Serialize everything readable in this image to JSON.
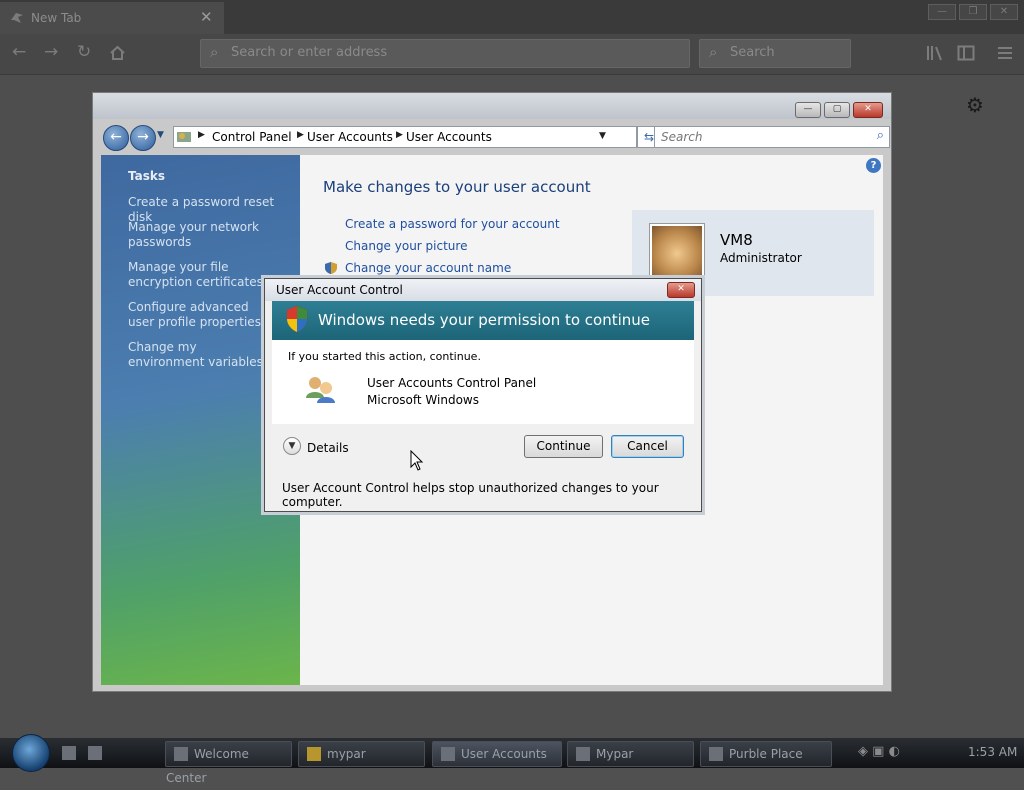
{
  "browser": {
    "tab_title": "New Tab",
    "address_placeholder": "Search or enter address",
    "search_placeholder": "Search"
  },
  "control_panel": {
    "breadcrumb": [
      "Control Panel",
      "User Accounts",
      "User Accounts"
    ],
    "search_placeholder": "Search",
    "tasks_heading": "Tasks",
    "tasks": [
      "Create a password reset disk",
      "Manage your network passwords",
      "Manage your file encryption certificates",
      "Configure advanced user profile properties",
      "Change my environment variables"
    ],
    "heading": "Make changes to your user account",
    "links": [
      "Create a password for your account",
      "Change your picture",
      "Change your account name"
    ],
    "user_name": "VM8",
    "user_role": "Administrator"
  },
  "uac": {
    "title": "User Account Control",
    "banner": "Windows needs your permission to continue",
    "intro": "If you started this action, continue.",
    "program": "User Accounts Control Panel",
    "publisher": "Microsoft Windows",
    "details_label": "Details",
    "continue_label": "Continue",
    "cancel_label": "Cancel",
    "footer": "User Account Control helps stop unauthorized changes to your computer."
  },
  "taskbar": {
    "buttons": [
      "Welcome Center",
      "mypar",
      "User Accounts",
      "Mypar",
      "Purble Place"
    ],
    "clock": "1:53 AM"
  },
  "colors": {
    "uac_banner": "#1d6578",
    "link_blue": "#1f4fa0",
    "sidebar_blue": "#3e69a0"
  }
}
